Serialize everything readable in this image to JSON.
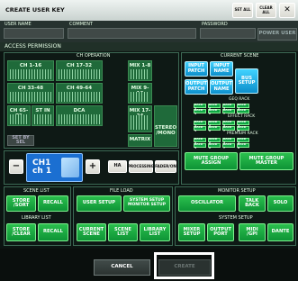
{
  "title": "CREATE USER KEY",
  "top_icons": {
    "set_all": "SET ALL",
    "clear_all": "CLEAR ALL"
  },
  "fields": {
    "user_name_label": "USER NAME",
    "comment_label": "COMMENT",
    "password_label": "PASSWORD",
    "power_user": "POWER USER"
  },
  "access_permission": "ACCESS PERMISSION",
  "ch_operation": {
    "title": "CH OPERATION",
    "groups": [
      "CH 1-16",
      "CH 17-32",
      "MIX 1-8",
      "CH 33-48",
      "CH 49-64",
      "MIX 9-16",
      "CH 65-72",
      "ST IN",
      "DCA",
      "MIX 17-24",
      "MATRIX",
      "STEREO\n/MONO"
    ],
    "set_by_sel": "SET BY SEL"
  },
  "channel": {
    "name_top": "CH1",
    "name_bottom": "ch 1",
    "minus": "−",
    "plus": "+",
    "ha": "HA",
    "processing": "PROCESSING",
    "fader_on": "FADER/ON"
  },
  "current_scene": {
    "title": "CURRENT SCENE",
    "buttons": [
      "INPUT\nPATCH",
      "INPUT\nNAME",
      "BUS\nSETUP",
      "OUTPUT\nPATCH",
      "OUTPUT\nNAME"
    ]
  },
  "geq_rack": {
    "title": "GEQ RACK",
    "cells": [
      "RACK 1",
      "RACK 2",
      "RACK 3",
      "RACK 4",
      "RACK 5",
      "RACK 6",
      "RACK 7",
      "RACK 8"
    ]
  },
  "effect_rack": {
    "title": "EFFECT RACK",
    "cells": [
      "RACK 1",
      "RACK 2",
      "RACK 3",
      "RACK 4",
      "RACK 5",
      "RACK 6",
      "RACK 7",
      "RACK 8"
    ]
  },
  "premium_rack": {
    "title": "PREMIUM RACK",
    "cells": [
      "RACK 1",
      "RACK 2",
      "RACK 3",
      "RACK 4",
      "RACK 5",
      "RACK 6",
      "RACK 7",
      "RACK 8"
    ]
  },
  "mute_group": {
    "assign": "MUTE GROUP\nASSIGN",
    "master": "MUTE GROUP\nMASTER"
  },
  "scene_list": {
    "title": "SCENE LIST",
    "store_sort": "STORE\n/SORT",
    "recall": "RECALL"
  },
  "library_list": {
    "title": "LIBRARY LIST",
    "store_clear": "STORE\n/CLEAR",
    "recall": "RECALL"
  },
  "file_load": {
    "title": "FILE LOAD",
    "user_setup": "USER SETUP",
    "system_setup": "SYSTEM SETUP\nMONITOR SETUP",
    "current_scene": "CURRENT\nSCENE",
    "scene_list": "SCENE\nLIST",
    "library_list": "LIBRARY\nLIST"
  },
  "monitor_setup": {
    "title": "MONITOR SETUP",
    "oscillator": "OSCILLATOR",
    "talkback": "TALK\nBACK",
    "solo": "SOLO"
  },
  "system_setup": {
    "title": "SYSTEM SETUP",
    "mixer_setup": "MIXER\nSETUP",
    "output_port": "OUTPUT\nPORT",
    "midi_gpi": "MIDI\n/GPI",
    "dante": "DANTE"
  },
  "footer": {
    "cancel": "CANCEL",
    "create": "CREATE"
  },
  "colors": {
    "panel": "#0c1512",
    "green": "#14a640",
    "cyan": "#22b8ee",
    "frame": "#3d6a55"
  }
}
